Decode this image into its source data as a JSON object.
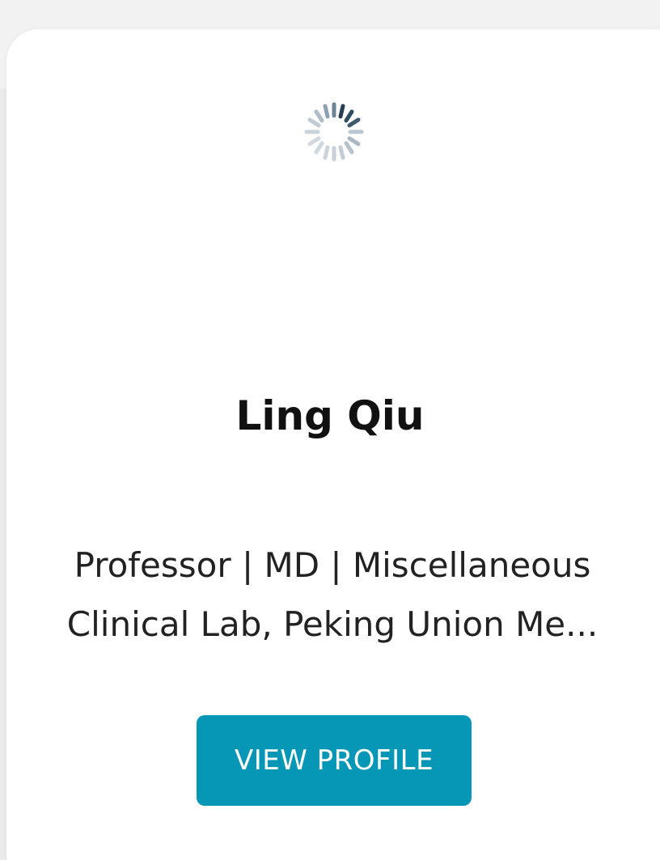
{
  "profile": {
    "name": "Ling Qiu",
    "subtitle_line1": "Professor | MD | Miscellaneous",
    "subtitle_line2": "Clinical Lab, Peking Union Me..."
  },
  "actions": {
    "view_profile_label": "VIEW PROFILE"
  },
  "icons": {
    "avatar_placeholder": "loading-spinner-icon"
  },
  "colors": {
    "button_bg": "#0697b6",
    "button_text": "#ffffff",
    "spinner_dark": "#2e4d62"
  }
}
